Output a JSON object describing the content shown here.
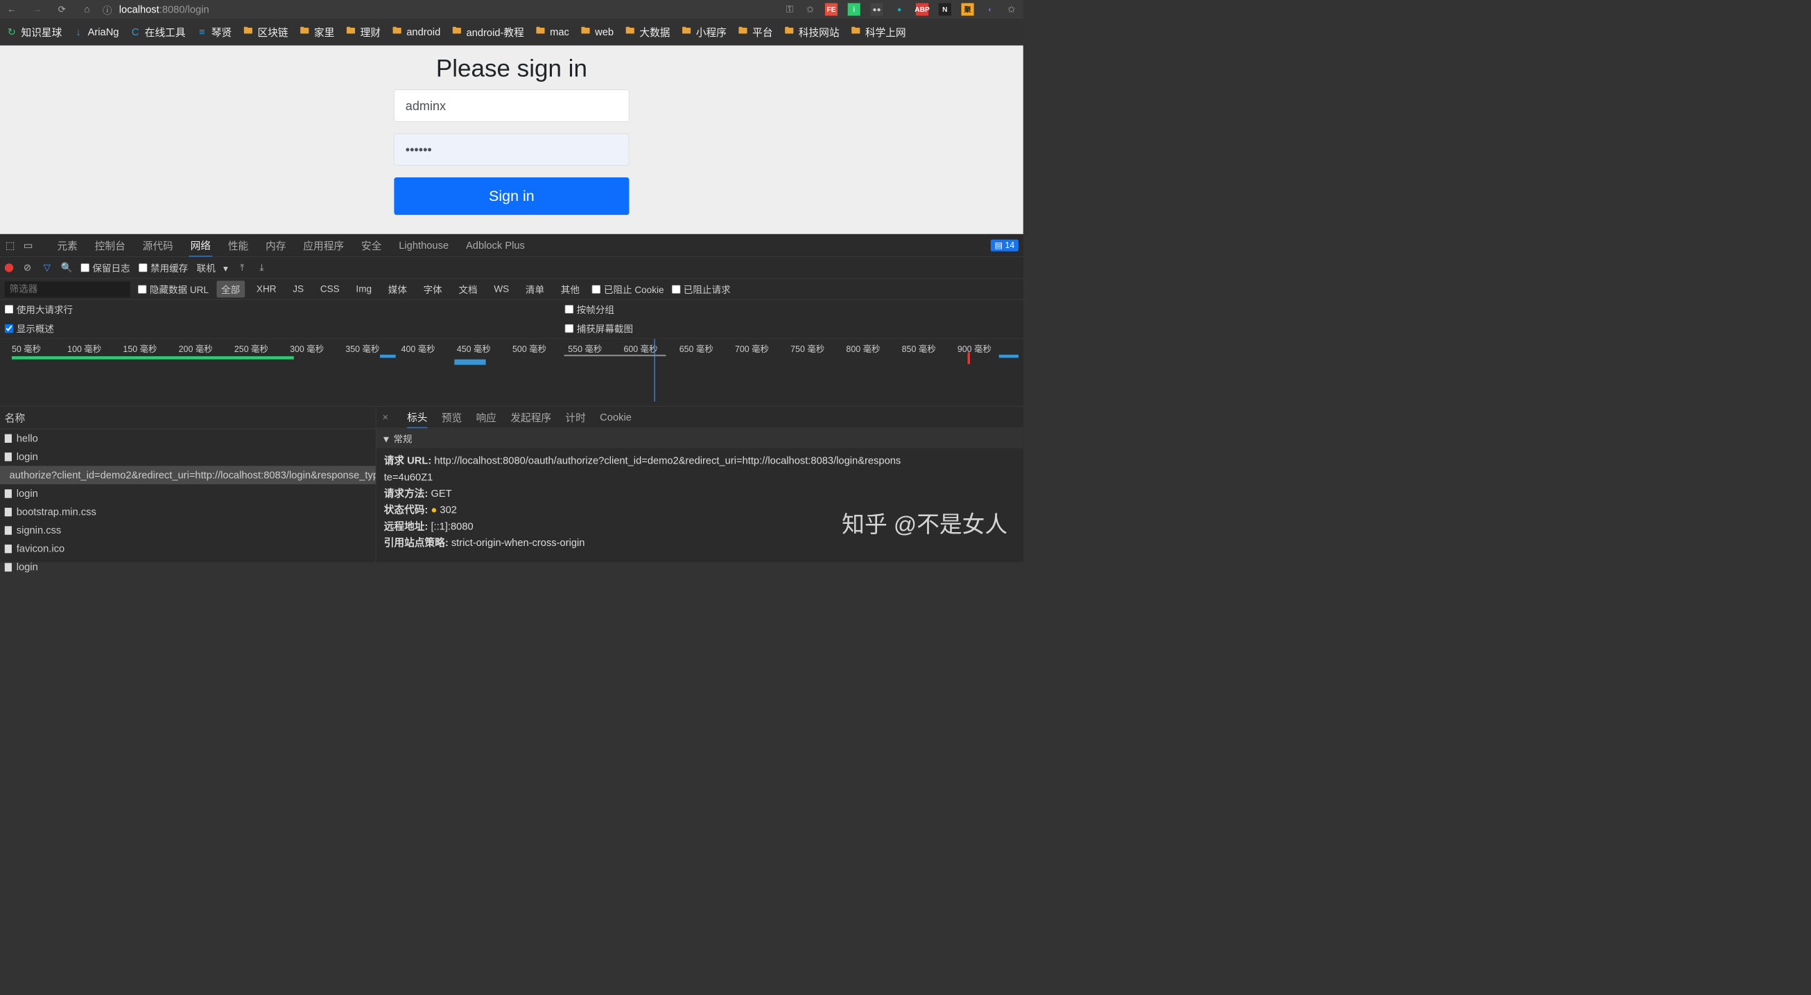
{
  "browser": {
    "url_host": "localhost",
    "url_port": ":8080",
    "url_path": "/login",
    "ext_badge_count": "14"
  },
  "extensions": [
    {
      "label": "FE",
      "bg": "#e74c3c",
      "fg": "#fff"
    },
    {
      "label": "i",
      "bg": "#2ecc71",
      "fg": "#fff"
    },
    {
      "label": "●●",
      "bg": "#444",
      "fg": "#ccc"
    },
    {
      "label": "●",
      "bg": "transparent",
      "fg": "#00bcd4"
    },
    {
      "label": "ABP",
      "bg": "#e53935",
      "fg": "#fff"
    },
    {
      "label": "N",
      "bg": "#222",
      "fg": "#eee"
    },
    {
      "label": "聚",
      "bg": "#f5a623",
      "fg": "#222"
    },
    {
      "label": "◐",
      "bg": "transparent",
      "fg": "#7b68ee"
    }
  ],
  "bookmarks": [
    {
      "icon": "↻",
      "color": "#2ecc71",
      "label": "知识星球"
    },
    {
      "icon": "↓",
      "color": "#3498db",
      "label": "AriaNg"
    },
    {
      "icon": "C",
      "color": "#3498db",
      "label": "在线工具"
    },
    {
      "icon": "≡",
      "color": "#3498db",
      "label": "琴贤"
    },
    {
      "icon": "folder",
      "label": "区块链"
    },
    {
      "icon": "folder",
      "label": "家里"
    },
    {
      "icon": "folder",
      "label": "理财"
    },
    {
      "icon": "folder",
      "label": "android"
    },
    {
      "icon": "folder",
      "label": "android-教程"
    },
    {
      "icon": "folder",
      "label": "mac"
    },
    {
      "icon": "folder",
      "label": "web"
    },
    {
      "icon": "folder",
      "label": "大数据"
    },
    {
      "icon": "folder",
      "label": "小程序"
    },
    {
      "icon": "folder",
      "label": "平台"
    },
    {
      "icon": "folder",
      "label": "科技网站"
    },
    {
      "icon": "folder",
      "label": "科学上网"
    }
  ],
  "page": {
    "title": "Please sign in",
    "username": "adminx",
    "password": "••••••",
    "signin": "Sign in"
  },
  "devtools": {
    "tabs": [
      "元素",
      "控制台",
      "源代码",
      "网络",
      "性能",
      "内存",
      "应用程序",
      "安全",
      "Lighthouse",
      "Adblock Plus"
    ],
    "active_tab": "网络",
    "warn_count": "14",
    "toolbar": {
      "preserve_log": "保留日志",
      "disable_cache": "禁用缓存",
      "online": "联机"
    },
    "filter": {
      "placeholder": "筛选器",
      "hide_data_urls": "隐藏数据 URL",
      "types": [
        "全部",
        "XHR",
        "JS",
        "CSS",
        "Img",
        "媒体",
        "字体",
        "文档",
        "WS",
        "清单",
        "其他"
      ],
      "blocked_cookies": "已阻止 Cookie",
      "blocked_requests": "已阻止请求"
    },
    "opts": {
      "large_rows": "使用大请求行",
      "overview": "显示概述",
      "group_by_frame": "按帧分组",
      "screenshots": "捕获屏幕截图"
    },
    "timeline_ticks": [
      "50 毫秒",
      "100 毫秒",
      "150 毫秒",
      "200 毫秒",
      "250 毫秒",
      "300 毫秒",
      "350 毫秒",
      "400 毫秒",
      "450 毫秒",
      "500 毫秒",
      "550 毫秒",
      "600 毫秒",
      "650 毫秒",
      "700 毫秒",
      "750 毫秒",
      "800 毫秒",
      "850 毫秒",
      "900 毫秒"
    ],
    "requests": {
      "header": "名称",
      "items": [
        {
          "name": "hello"
        },
        {
          "name": "login"
        },
        {
          "name": "authorize?client_id=demo2&redirect_uri=http://localhost:8083/login&response_typ...",
          "selected": true
        },
        {
          "name": "login"
        },
        {
          "name": "bootstrap.min.css"
        },
        {
          "name": "signin.css"
        },
        {
          "name": "favicon.ico"
        },
        {
          "name": "login"
        }
      ]
    },
    "detail": {
      "tabs": [
        "标头",
        "预览",
        "响应",
        "发起程序",
        "计时",
        "Cookie"
      ],
      "active": "标头",
      "section": "常规",
      "rows": [
        {
          "k": "请求 URL:",
          "v": "http://localhost:8080/oauth/authorize?client_id=demo2&redirect_uri=http://localhost:8083/login&respons",
          "wrap": "te=4u60Z1"
        },
        {
          "k": "请求方法:",
          "v": "GET"
        },
        {
          "k": "状态代码:",
          "v": "302",
          "status": true
        },
        {
          "k": "远程地址:",
          "v": "[::1]:8080"
        },
        {
          "k": "引用站点策略:",
          "v": "strict-origin-when-cross-origin"
        }
      ]
    }
  },
  "watermark": "知乎 @不是女人"
}
